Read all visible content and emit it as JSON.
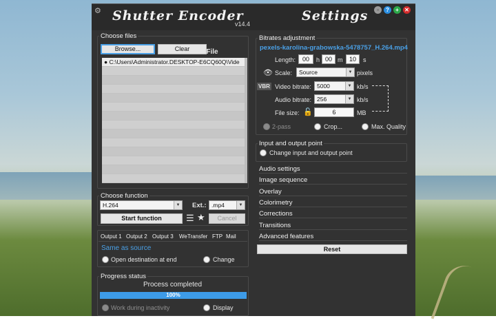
{
  "window": {
    "title": "Shutter Encoder",
    "version": "v14.4",
    "settings_title": "Settings"
  },
  "choose_files": {
    "legend": "Choose files",
    "browse_label": "Browse...",
    "clear_label": "Clear",
    "file_count": "1 File",
    "files": [
      "C:\\Users\\Administrator.DESKTOP-E6CQ60Q\\Vide"
    ]
  },
  "choose_function": {
    "legend": "Choose function",
    "function_value": "H.264",
    "ext_label": "Ext.:",
    "ext_value": ".mp4",
    "start_label": "Start function",
    "cancel_label": "Cancel"
  },
  "output": {
    "tabs": [
      "Output 1",
      "Output 2",
      "Output 3",
      "WeTransfer",
      "FTP",
      "Mail"
    ],
    "same_as_source": "Same as source",
    "open_destination_label": "Open destination at end",
    "change_label": "Change"
  },
  "progress": {
    "legend": "Progress status",
    "status_text": "Process completed",
    "percent_text": "100%",
    "percent_value": 100,
    "work_inactivity_label": "Work during inactivity",
    "display_label": "Display"
  },
  "bitrates": {
    "legend": "Bitrates adjustment",
    "filename": "pexels-karolina-grabowska-5478757_H.264.mp4",
    "length_label": "Length:",
    "hours": "00",
    "h_unit": "h",
    "minutes": "00",
    "m_unit": "m",
    "seconds": "10",
    "s_unit": "s",
    "scale_label": "Scale:",
    "scale_value": "Source",
    "scale_unit": "pixels",
    "vbr_label": "VBR",
    "video_bitrate_label": "Video bitrate:",
    "video_bitrate_value": "5000",
    "video_unit": "kb/s",
    "audio_bitrate_label": "Audio bitrate:",
    "audio_bitrate_value": "256",
    "audio_unit": "kb/s",
    "file_size_label": "File size:",
    "file_size_value": "6",
    "file_size_unit": "MB",
    "two_pass_label": "2-pass",
    "crop_label": "Crop...",
    "max_quality_label": "Max. Quality"
  },
  "io_point": {
    "legend": "Input and output point",
    "change_label": "Change input and output point"
  },
  "sections": [
    "Audio settings",
    "Image sequence",
    "Overlay",
    "Colorimetry",
    "Corrections",
    "Transitions",
    "Advanced features"
  ],
  "reset_label": "Reset",
  "colors": {
    "accent": "#3d9be8",
    "window_bg": "#323232"
  }
}
